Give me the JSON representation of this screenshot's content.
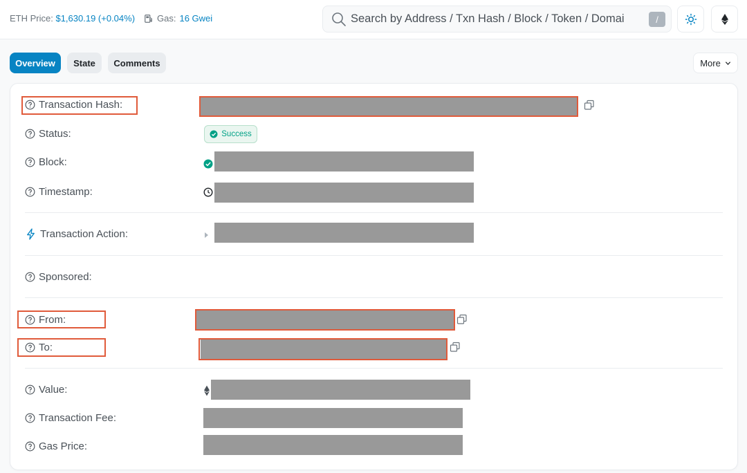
{
  "header": {
    "eth_price_label": "ETH Price:",
    "eth_price_value": "$1,630.19 (+0.04%)",
    "gas_label": "Gas:",
    "gas_value": "16 Gwei",
    "search_placeholder": "Search by Address / Txn Hash / Block / Token / Domai",
    "search_shortcut": "/",
    "icons": [
      "gas-pump-icon",
      "search-icon",
      "theme-toggle-icon",
      "ethereum-icon"
    ]
  },
  "tabs": [
    {
      "label": "Overview",
      "active": true
    },
    {
      "label": "State",
      "active": false
    },
    {
      "label": "Comments",
      "active": false
    }
  ],
  "more_label": "More",
  "details": {
    "transaction_hash": "Transaction Hash:",
    "status": "Status:",
    "status_value": "Success",
    "block": "Block:",
    "timestamp": "Timestamp:",
    "transaction_action": "Transaction Action:",
    "sponsored": "Sponsored:",
    "from": "From:",
    "to": "To:",
    "value": "Value:",
    "transaction_fee": "Transaction Fee:",
    "gas_price": "Gas Price:"
  },
  "colors": {
    "accent": "#0784c3",
    "success": "#00a186",
    "highlight": "#e05a3a",
    "redaction": "#999999"
  }
}
